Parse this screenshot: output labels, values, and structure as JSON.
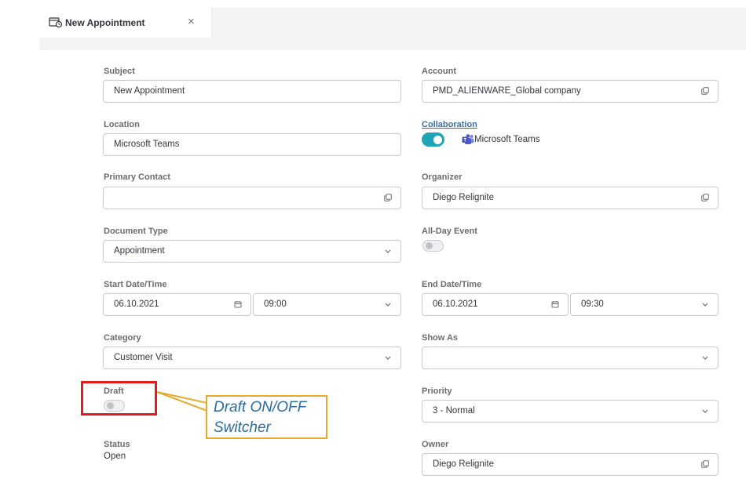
{
  "tab": {
    "title": "New Appointment",
    "close_glyph": "×",
    "icon": "appointment-icon"
  },
  "left": {
    "subject": {
      "label": "Subject",
      "value": "New Appointment"
    },
    "location": {
      "label": "Location",
      "value": "Microsoft Teams"
    },
    "primary_contact": {
      "label": "Primary Contact",
      "value": ""
    },
    "document_type": {
      "label": "Document Type",
      "value": "Appointment"
    },
    "start": {
      "label": "Start Date/Time",
      "date": "06.10.2021",
      "time": "09:00"
    },
    "category": {
      "label": "Category",
      "value": "Customer Visit"
    },
    "draft": {
      "label": "Draft",
      "on": false
    },
    "status": {
      "label": "Status",
      "value": "Open"
    }
  },
  "right": {
    "account": {
      "label": "Account",
      "value": "PMD_ALIENWARE_Global company"
    },
    "collaboration": {
      "label": "Collaboration",
      "on": true,
      "app": "Microsoft Teams"
    },
    "organizer": {
      "label": "Organizer",
      "value": "Diego Relignite"
    },
    "all_day": {
      "label": "All-Day Event",
      "on": false
    },
    "end": {
      "label": "End Date/Time",
      "date": "06.10.2021",
      "time": "09:30"
    },
    "show_as": {
      "label": "Show As",
      "value": ""
    },
    "priority": {
      "label": "Priority",
      "value": "3 - Normal"
    },
    "owner": {
      "label": "Owner",
      "value": "Diego Relignite"
    }
  },
  "annotation": {
    "line1": "Draft ON/OFF",
    "line2": "Switcher"
  },
  "colors": {
    "toggle_on": "#1ea5b7",
    "highlight": "#e8191b",
    "callout_border": "#e5a92c",
    "callout_text": "#2d6d9e"
  }
}
